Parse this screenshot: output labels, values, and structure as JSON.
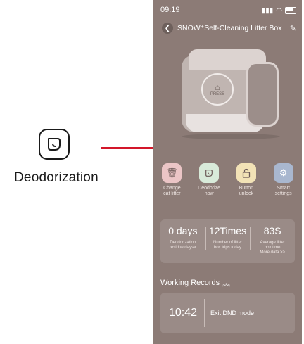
{
  "annotation": {
    "label": "Deodorization",
    "icon": "deodorize-icon",
    "line_color": "#d3172a"
  },
  "status_bar": {
    "time": "09:19"
  },
  "header": {
    "title": "SNOW⁺Self-Cleaning Litter Box"
  },
  "device": {
    "button_text": "PRESS"
  },
  "actions": [
    {
      "label_line1": "Change",
      "label_line2": "cat litter",
      "icon": "trash-icon",
      "color": "#ebc5c6"
    },
    {
      "label_line1": "Deodorize",
      "label_line2": "now",
      "icon": "deodorize-icon",
      "color": "#d8ead9"
    },
    {
      "label_line1": "Button",
      "label_line2": "unlock",
      "icon": "unlock-icon",
      "color": "#f2e2b6"
    },
    {
      "label_line1": "Smart",
      "label_line2": "settings",
      "icon": "gear-icon",
      "color": "#a9b7cf"
    }
  ],
  "stats": [
    {
      "value": "0 days",
      "label_line1": "Deodorization",
      "label_line2": "residue days>"
    },
    {
      "value": "12Times",
      "label_line1": "Number of litter",
      "label_line2": "box trips today"
    },
    {
      "value": "83S",
      "label_line1": "Average litter",
      "label_line2": "box time",
      "link": "More data >>"
    }
  ],
  "records": {
    "title": "Working Records",
    "items": [
      {
        "time": "10:42",
        "text": "Exit DND mode"
      }
    ]
  }
}
